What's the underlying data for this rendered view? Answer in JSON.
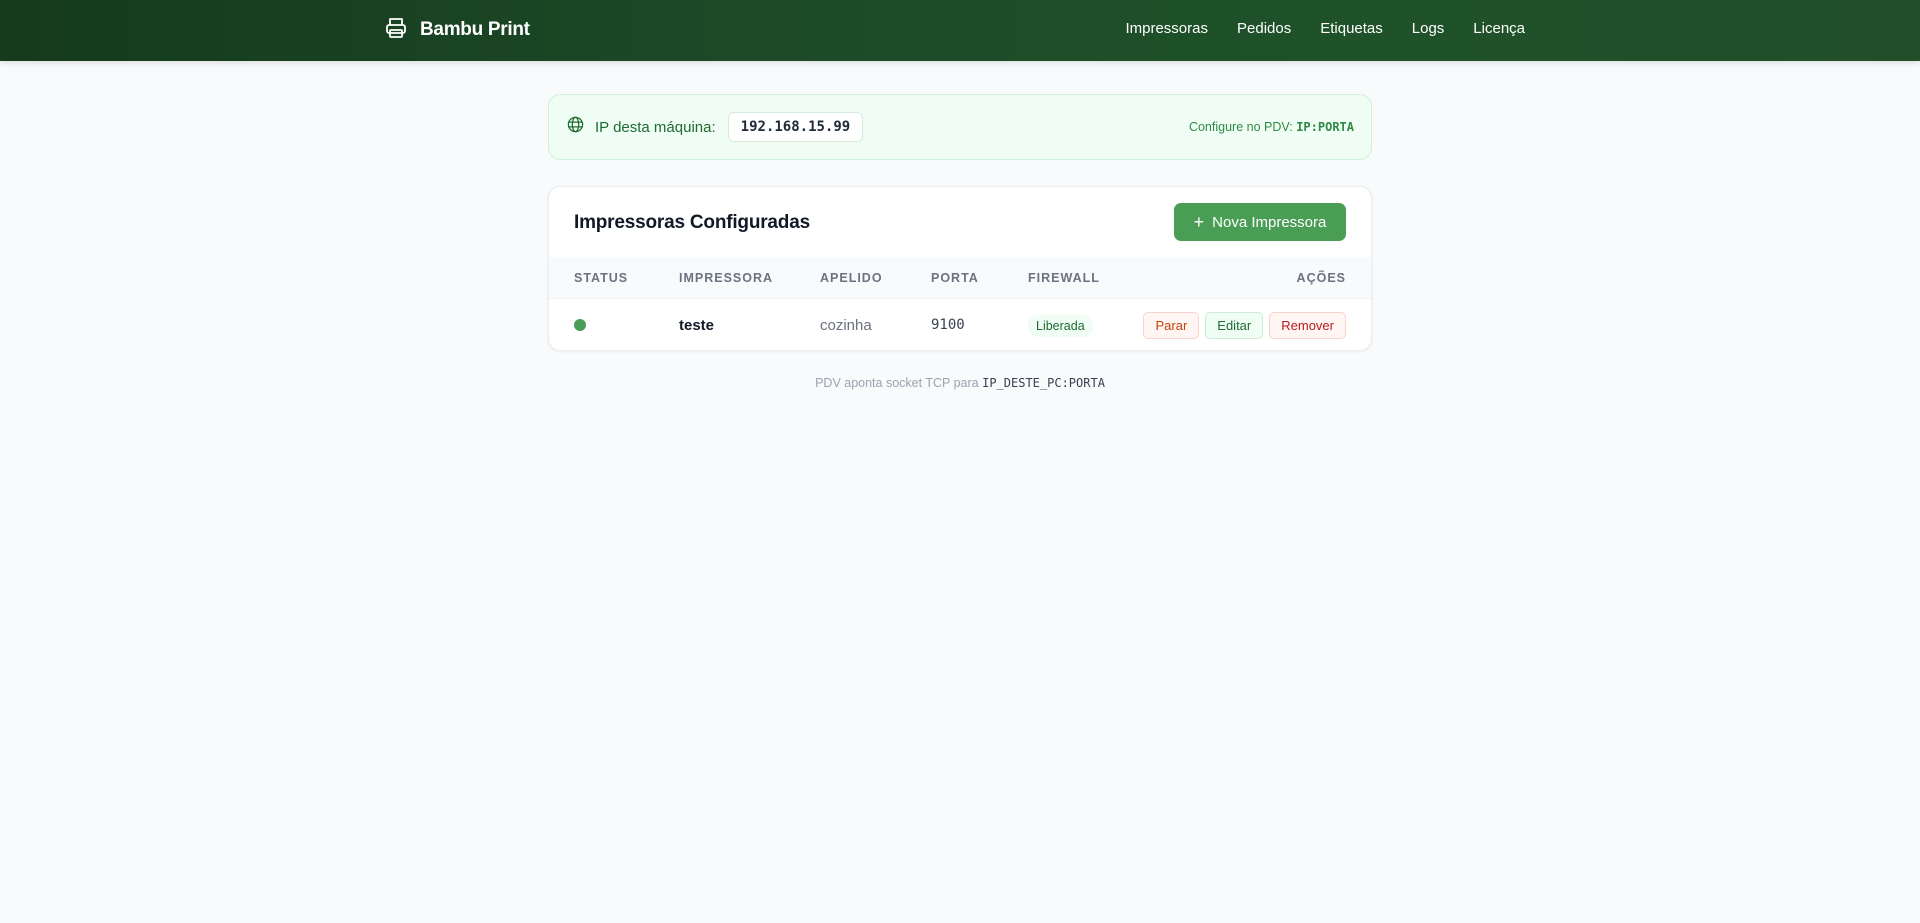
{
  "header": {
    "brand": "Bambu Print",
    "brand_icon": "printer-icon",
    "nav": [
      "Impressoras",
      "Pedidos",
      "Etiquetas",
      "Logs",
      "Licença"
    ]
  },
  "ip_panel": {
    "icon": "globe-icon",
    "label": "IP desta máquina:",
    "value": "192.168.15.99",
    "hint_prefix": "Configure no PDV:",
    "hint_code": "IP:PORTA"
  },
  "printers": {
    "title": "Impressoras Configuradas",
    "new_button": "Nova Impressora",
    "columns": {
      "status": "STATUS",
      "printer": "IMPRESSORA",
      "alias": "APELIDO",
      "port": "PORTA",
      "firewall": "FIREWALL",
      "actions": "AÇÕES"
    },
    "rows": [
      {
        "status_color": "#4a9d55",
        "name": "teste",
        "alias": "cozinha",
        "port": "9100",
        "firewall": "Liberada",
        "actions": {
          "stop": "Parar",
          "edit": "Editar",
          "remove": "Remover"
        }
      }
    ]
  },
  "footer": {
    "text": "PDV aponta socket TCP para",
    "code": "IP_DESTE_PC:PORTA"
  },
  "colors": {
    "accent": "#4a9d55",
    "header": "#1c4a27",
    "danger": "#b91c1c"
  }
}
